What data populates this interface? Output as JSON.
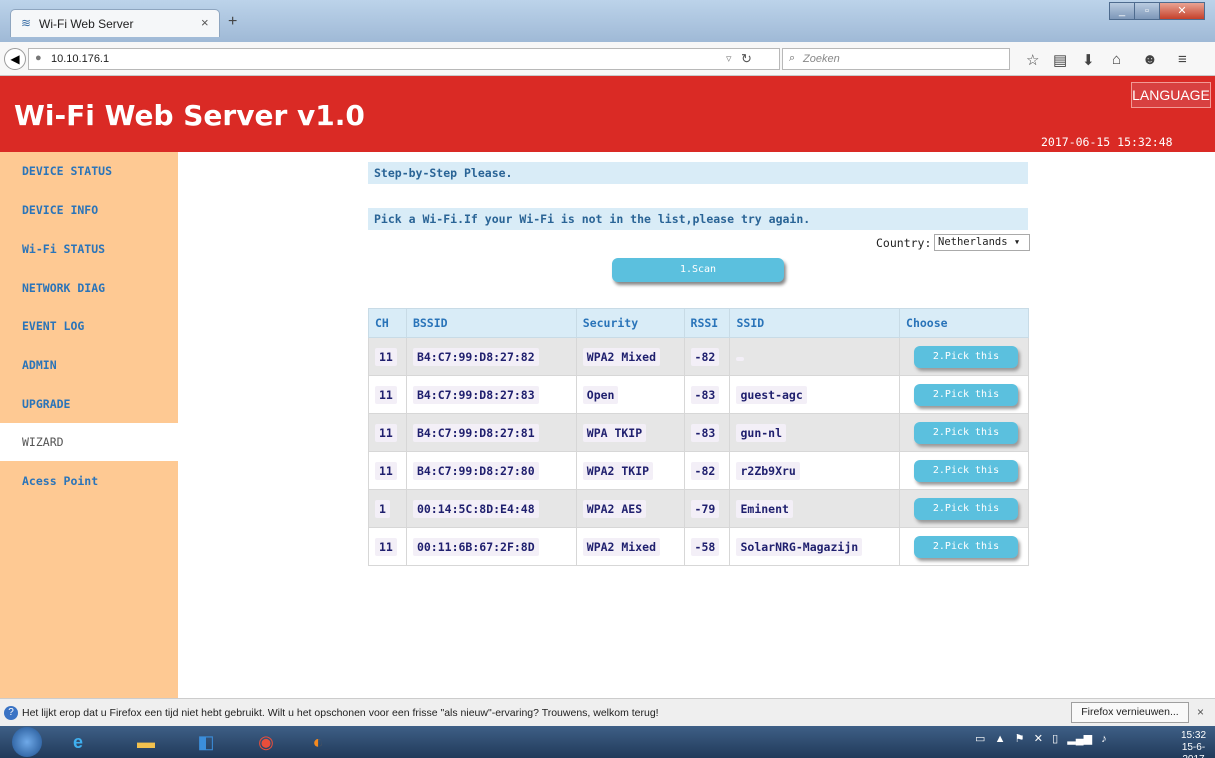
{
  "browser": {
    "tab_title": "Wi-Fi Web Server",
    "tab_close": "×",
    "new_tab": "+",
    "url": "10.10.176.1",
    "search_placeholder": "Zoeken",
    "icons": [
      "back-icon",
      "globe-icon",
      "reload-icon",
      "search-icon",
      "bookmark-star-icon",
      "bookmarks-list-icon",
      "download-icon",
      "home-icon",
      "chat-icon",
      "menu-icon"
    ]
  },
  "header": {
    "title": "Wi-Fi Web Server v1.0",
    "language_button": "LANGUAGE",
    "datetime": "2017-06-15 15:32:48",
    "color": "#da2a25"
  },
  "sidebar": {
    "items": [
      {
        "label": "DEVICE STATUS"
      },
      {
        "label": "DEVICE INFO"
      },
      {
        "label": "Wi-Fi STATUS"
      },
      {
        "label": "NETWORK DIAG"
      },
      {
        "label": "EVENT LOG"
      },
      {
        "label": "ADMIN"
      },
      {
        "label": "UPGRADE"
      },
      {
        "label": "WIZARD",
        "active": true
      },
      {
        "label": "Acess Point"
      }
    ]
  },
  "main": {
    "step_text": "Step-by-Step Please.",
    "pick_text": "Pick a Wi-Fi.If your Wi-Fi is not in the list,please try again.",
    "country_label": "Country:",
    "country_value": "Netherlands",
    "scan_button": "1.Scan",
    "table": {
      "headers": [
        "CH",
        "BSSID",
        "Security",
        "RSSI",
        "SSID",
        "Choose"
      ],
      "rows": [
        {
          "ch": "11",
          "bssid": "B4:C7:99:D8:27:82",
          "security": "WPA2 Mixed",
          "rssi": "-82",
          "ssid": "",
          "action": "2.Pick this"
        },
        {
          "ch": "11",
          "bssid": "B4:C7:99:D8:27:83",
          "security": "Open",
          "rssi": "-83",
          "ssid": "guest-agc",
          "action": "2.Pick this"
        },
        {
          "ch": "11",
          "bssid": "B4:C7:99:D8:27:81",
          "security": "WPA TKIP",
          "rssi": "-83",
          "ssid": "gun-nl",
          "action": "2.Pick this"
        },
        {
          "ch": "11",
          "bssid": "B4:C7:99:D8:27:80",
          "security": "WPA2 TKIP",
          "rssi": "-82",
          "ssid": "r2Zb9Xru",
          "action": "2.Pick this"
        },
        {
          "ch": "1",
          "bssid": "00:14:5C:8D:E4:48",
          "security": "WPA2 AES",
          "rssi": "-79",
          "ssid": "Eminent",
          "action": "2.Pick this"
        },
        {
          "ch": "11",
          "bssid": "00:11:6B:67:2F:8D",
          "security": "WPA2 Mixed",
          "rssi": "-58",
          "ssid": "SolarNRG-Magazijn",
          "action": "2.Pick this"
        }
      ]
    }
  },
  "notification": {
    "text": "Het lijkt erop dat u Firefox een tijd niet hebt gebruikt. Wilt u het opschonen voor een frisse \"als nieuw\"-ervaring? Trouwens, welkom terug!",
    "button": "Firefox vernieuwen...",
    "close": "×"
  },
  "taskbar": {
    "time": "15:32",
    "date": "15-6-2017",
    "apps": [
      "ie-icon",
      "explorer-icon",
      "outlook-icon",
      "chrome-icon",
      "firefox-icon"
    ]
  }
}
